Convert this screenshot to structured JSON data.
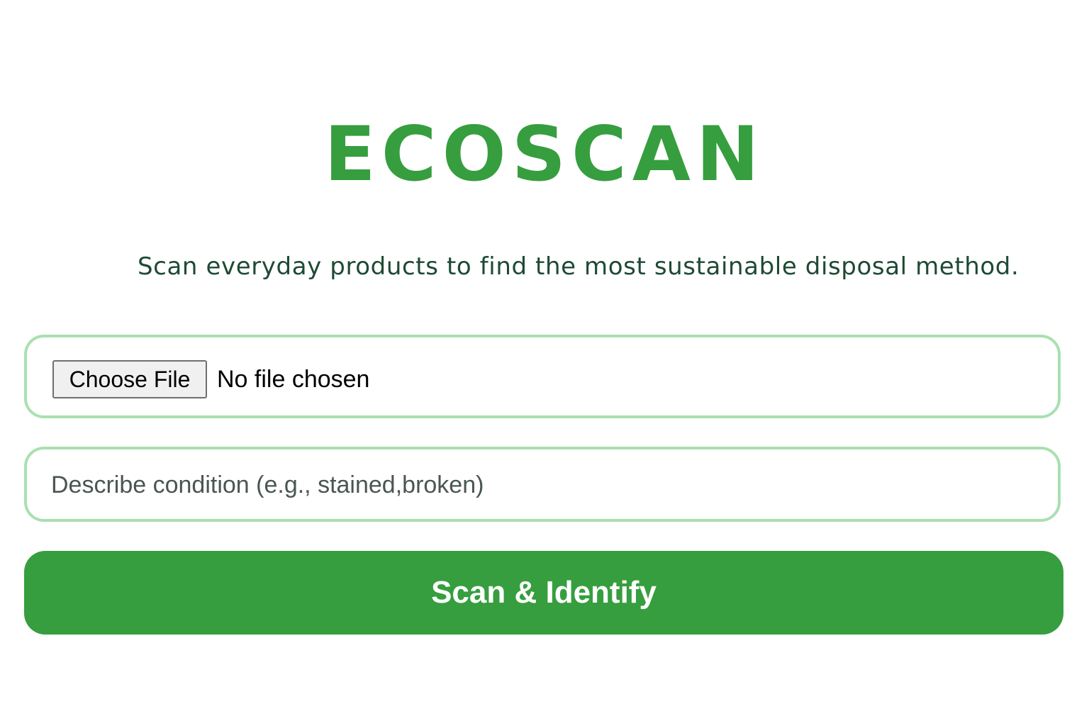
{
  "app": {
    "title": "ECOSCAN",
    "tagline": "Scan everyday products to find the most sustainable disposal method."
  },
  "file_input": {
    "button_label": "Choose File",
    "status": "No file chosen"
  },
  "condition_input": {
    "value": "",
    "placeholder": "Describe condition (e.g., stained,broken)"
  },
  "scan_button": {
    "label": "Scan & Identify"
  },
  "colors": {
    "brand_green": "#369e3e",
    "tagline_text": "#1e4a33",
    "input_border": "#a9e0b0",
    "button_text": "#ffffff"
  }
}
